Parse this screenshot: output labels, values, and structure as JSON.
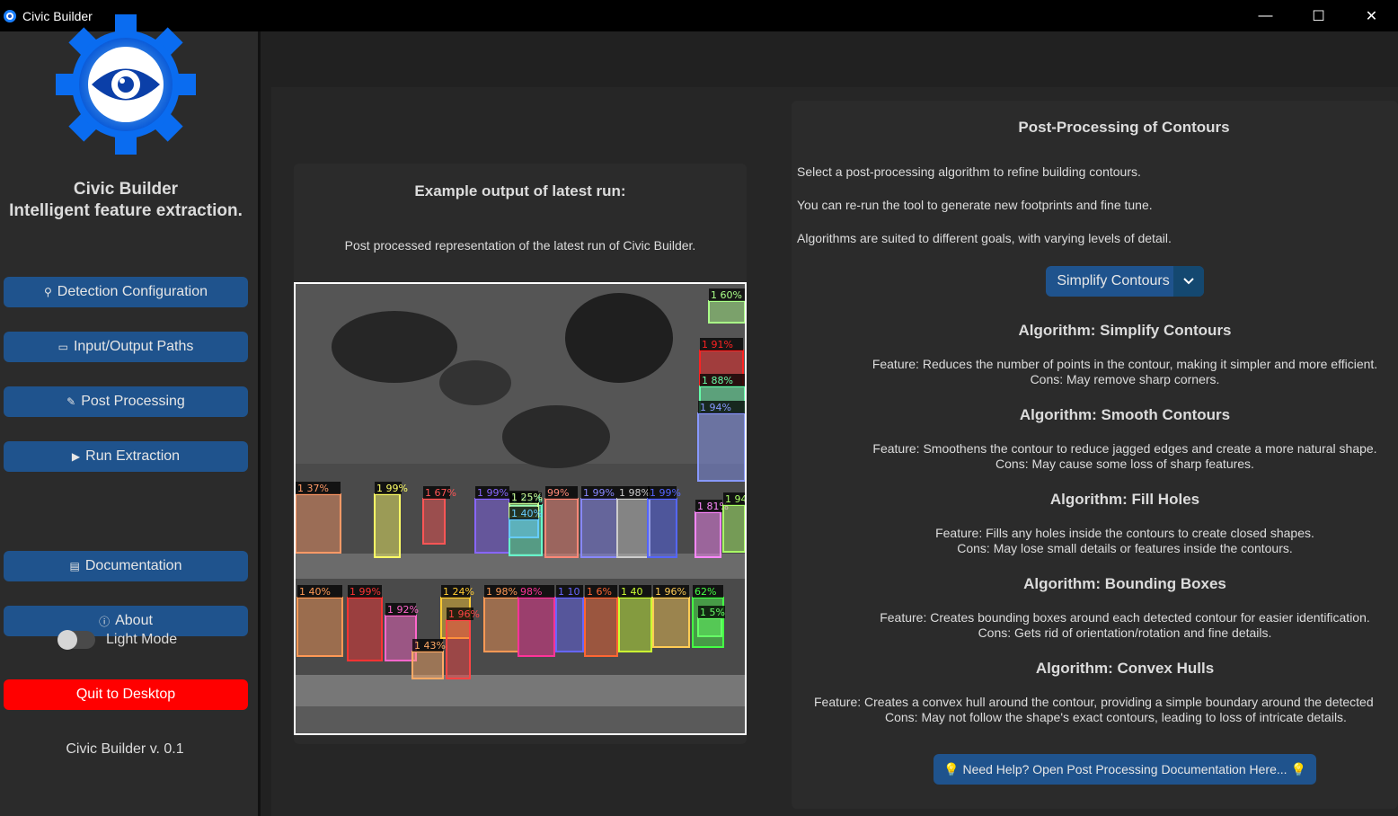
{
  "window": {
    "title": "Civic Builder",
    "minimize_glyph": "—",
    "maximize_glyph": "☐",
    "close_glyph": "✕"
  },
  "sidebar": {
    "logo_icon": "gear-eye-icon",
    "title_line1": "Civic Builder",
    "title_line2": "Intelligent feature extraction.",
    "items": [
      {
        "label": "Detection Configuration",
        "icon": "search-icon",
        "glyph": "⚲"
      },
      {
        "label": "Input/Output Paths",
        "icon": "folder-icon",
        "glyph": "▭"
      },
      {
        "label": "Post Processing",
        "icon": "pencil-icon",
        "glyph": "✎"
      },
      {
        "label": "Run Extraction",
        "icon": "play-icon",
        "glyph": "▶"
      },
      {
        "label": "Documentation",
        "icon": "document-icon",
        "glyph": "▤"
      },
      {
        "label": "About",
        "icon": "info-icon",
        "glyph": "ⓘ"
      }
    ],
    "toggle_label": "Light Mode",
    "quit_label": "Quit to Desktop",
    "version": "Civic Builder v. 0.1"
  },
  "example": {
    "title": "Example output of latest run:",
    "description": "Post processed representation of the latest run of Civic Builder.",
    "image_labels": [
      "1 37%",
      "1 99%",
      "1 67%",
      "1 99%",
      "1 93%",
      "99%",
      "1 99%",
      "1 98%",
      "1 99%",
      "1 81%",
      "1 94",
      "1 25%",
      "1 40%",
      "1 40%",
      "1 99%",
      "1 92%",
      "1 24%",
      "1 98%",
      "98%",
      "1 10",
      "1 6%",
      "1 40",
      "1 96%",
      "62%",
      "1 96%",
      "1 43%",
      "1 5%",
      "1 60%",
      "1 91%",
      "1 88%",
      "1 94%"
    ]
  },
  "post_processing": {
    "title": "Post-Processing of Contours",
    "paragraphs": [
      "Select a post-processing algorithm to refine building contours.",
      "You can re-run the tool to generate new footprints and fine tune.",
      "Algorithms are suited to different goals, with varying levels of detail."
    ],
    "dropdown_value": "Simplify Contours",
    "algorithms": [
      {
        "title": "Algorithm: Simplify Contours",
        "feature": "Feature: Reduces the number of points in the contour, making it simpler and more efficient.",
        "cons": "Cons: May remove sharp corners."
      },
      {
        "title": "Algorithm: Smooth Contours",
        "feature": "Feature: Smoothens the contour to reduce jagged edges and create a more natural shape.",
        "cons": "Cons: May cause some loss of sharp features."
      },
      {
        "title": "Algorithm: Fill Holes",
        "feature": "Feature: Fills any holes inside the contours to create closed shapes.",
        "cons": "Cons: May lose small details or features inside the contours."
      },
      {
        "title": "Algorithm: Bounding Boxes",
        "feature": "Feature: Creates bounding boxes around each detected contour for easier identification.",
        "cons": "Cons: Gets rid of orientation/rotation and fine details."
      },
      {
        "title": "Algorithm: Convex Hulls",
        "feature": "Feature: Creates a convex hull around the contour, providing a simple boundary around the detected",
        "cons": "Cons: May not follow the shape's exact contours, leading to loss of intricate details."
      }
    ],
    "help_label": "Need Help? Open Post Processing Documentation Here...",
    "help_icon": "lightbulb-icon",
    "help_glyph": "💡"
  },
  "colors": {
    "accent": "#1f538d",
    "quit": "#ff0000",
    "sidebar_bg": "#2b2b2b",
    "main_bg": "#212121"
  }
}
